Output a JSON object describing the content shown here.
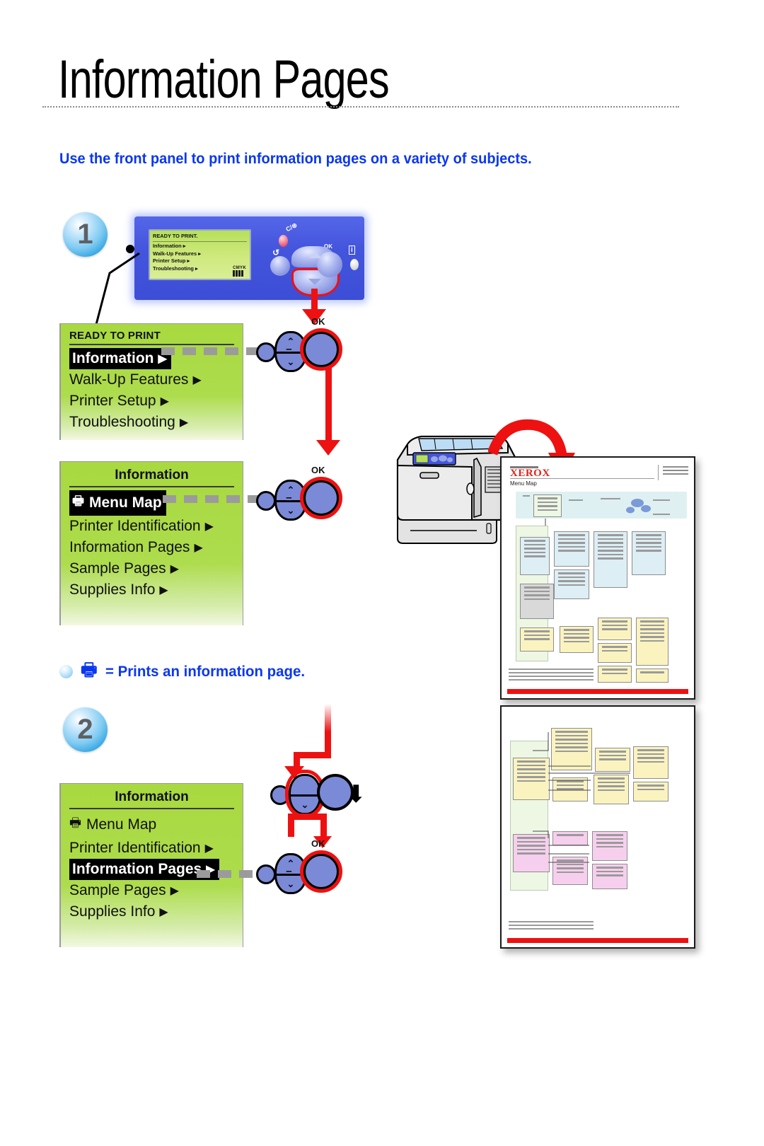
{
  "page": {
    "title": "Information Pages",
    "subtitle": "Use the front panel to print information pages on a variety of subjects."
  },
  "steps": [
    {
      "number": "1"
    },
    {
      "number": "2"
    }
  ],
  "front_panel": {
    "lcd": {
      "status": "READY TO PRINT.",
      "items": [
        "Information ▸",
        "Walk-Up Features ▸",
        "Printer Setup ▸",
        "Troubleshooting ▸"
      ],
      "ink_label": "CMYK"
    },
    "labels": {
      "cancel": "C/⊗",
      "back": "↺",
      "ok": "OK",
      "info": "i"
    }
  },
  "menu_screens": [
    {
      "status": "READY TO PRINT",
      "items": [
        {
          "label": "Information",
          "arrow": "▶",
          "selected": true,
          "print_icon": false
        },
        {
          "label": "Walk-Up Features",
          "arrow": "▶",
          "selected": false,
          "print_icon": false
        },
        {
          "label": "Printer Setup",
          "arrow": "▶",
          "selected": false,
          "print_icon": false
        },
        {
          "label": "Troubleshooting",
          "arrow": "▶",
          "selected": false,
          "print_icon": false
        }
      ]
    },
    {
      "title": "Information",
      "items": [
        {
          "label": "Menu Map",
          "arrow": "",
          "selected": true,
          "print_icon": true
        },
        {
          "label": "Printer Identification",
          "arrow": "▶",
          "selected": false,
          "print_icon": false
        },
        {
          "label": "Information Pages",
          "arrow": "▶",
          "selected": false,
          "print_icon": false
        },
        {
          "label": "Sample Pages",
          "arrow": "▶",
          "selected": false,
          "print_icon": false
        },
        {
          "label": "Supplies Info",
          "arrow": "▶",
          "selected": false,
          "print_icon": false
        }
      ]
    },
    {
      "title": "Information",
      "items": [
        {
          "label": "Menu Map",
          "arrow": "",
          "selected": false,
          "print_icon": true
        },
        {
          "label": "Printer Identification",
          "arrow": "▶",
          "selected": false,
          "print_icon": false
        },
        {
          "label": "Information Pages",
          "arrow": "▶",
          "selected": true,
          "print_icon": false
        },
        {
          "label": "Sample Pages",
          "arrow": "▶",
          "selected": false,
          "print_icon": false
        },
        {
          "label": "Supplies Info",
          "arrow": "▶",
          "selected": false,
          "print_icon": false
        }
      ]
    }
  ],
  "clusters": {
    "ok_label": "OK",
    "up_glyph": "⌃",
    "down_glyph": "⌄",
    "equals": "="
  },
  "legend": {
    "text": "= Prints an information page.",
    "icon": "printer-icon"
  },
  "printed_pages": [
    {
      "brand": "XEROX",
      "name": "Menu Map"
    },
    {
      "brand": "",
      "name": ""
    }
  ],
  "colors": {
    "accent_blue": "#0a37ef",
    "arrow_red": "#ee1111",
    "lcd_green": "#addc4d",
    "panel_blue": "#4455dd",
    "xerox_red": "#e32119"
  }
}
